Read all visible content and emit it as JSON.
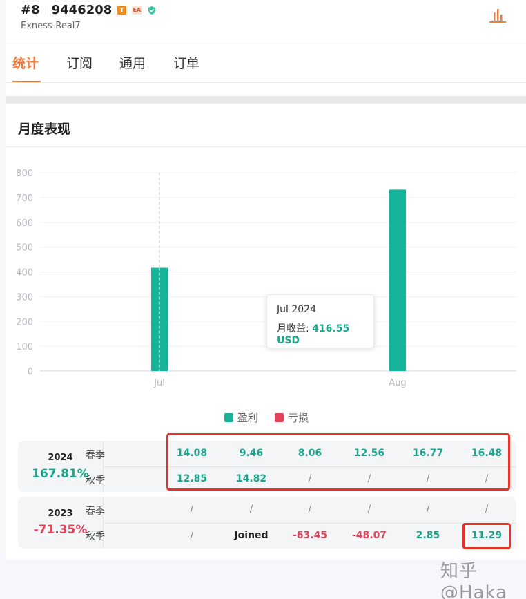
{
  "header": {
    "rank": "#8",
    "account_id": "9446208",
    "badge_t": "T",
    "badge_ea": "EA",
    "server": "Exness-Real7"
  },
  "tabs": [
    {
      "label": "统计",
      "active": true
    },
    {
      "label": "订阅",
      "active": false
    },
    {
      "label": "通用",
      "active": false
    },
    {
      "label": "订单",
      "active": false
    }
  ],
  "section": {
    "title": "月度表现"
  },
  "chart_data": {
    "type": "bar",
    "categories": [
      "Jul",
      "Aug"
    ],
    "series": [
      {
        "name": "盈利",
        "values": [
          416.55,
          732
        ],
        "color": "#14b39a"
      }
    ],
    "ylim": [
      0,
      800
    ],
    "yticks": [
      "0",
      "100",
      "200",
      "300",
      "400",
      "500",
      "600",
      "700",
      "800"
    ],
    "grid": true,
    "xlabel": "",
    "ylabel": ""
  },
  "tooltip": {
    "title": "Jul 2024",
    "label": "月收益:",
    "value": "416.55 USD"
  },
  "legend": [
    {
      "label": "盈利",
      "color": "#14b39a"
    },
    {
      "label": "亏损",
      "color": "#e2445c"
    }
  ],
  "performance": [
    {
      "year": "2024",
      "total": "167.81%",
      "total_sign": "pos",
      "rows": [
        {
          "label": "春季",
          "cells": [
            {
              "text": "14.08",
              "kind": "pos"
            },
            {
              "text": "9.46",
              "kind": "pos"
            },
            {
              "text": "8.06",
              "kind": "pos"
            },
            {
              "text": "12.56",
              "kind": "pos"
            },
            {
              "text": "16.77",
              "kind": "pos"
            },
            {
              "text": "16.48",
              "kind": "pos"
            }
          ]
        },
        {
          "label": "秋季",
          "cells": [
            {
              "text": "12.85",
              "kind": "pos"
            },
            {
              "text": "14.82",
              "kind": "pos"
            },
            {
              "text": "/",
              "kind": "neutral"
            },
            {
              "text": "/",
              "kind": "neutral"
            },
            {
              "text": "/",
              "kind": "neutral"
            },
            {
              "text": "/",
              "kind": "neutral"
            }
          ]
        }
      ]
    },
    {
      "year": "2023",
      "total": "-71.35%",
      "total_sign": "neg",
      "rows": [
        {
          "label": "春季",
          "cells": [
            {
              "text": "/",
              "kind": "neutral"
            },
            {
              "text": "/",
              "kind": "neutral"
            },
            {
              "text": "/",
              "kind": "neutral"
            },
            {
              "text": "/",
              "kind": "neutral"
            },
            {
              "text": "/",
              "kind": "neutral"
            },
            {
              "text": "/",
              "kind": "neutral"
            }
          ]
        },
        {
          "label": "秋季",
          "cells": [
            {
              "text": "/",
              "kind": "neutral"
            },
            {
              "text": "Joined",
              "kind": "joined"
            },
            {
              "text": "-63.45",
              "kind": "neg"
            },
            {
              "text": "-48.07",
              "kind": "neg"
            },
            {
              "text": "2.85",
              "kind": "pos"
            },
            {
              "text": "11.29",
              "kind": "pos"
            }
          ]
        }
      ]
    }
  ],
  "watermark": "知乎 @Haka",
  "colors": {
    "accent": "#f07a3a",
    "profit": "#14b39a",
    "loss": "#e2445c",
    "highlight_box": "#e53325"
  }
}
